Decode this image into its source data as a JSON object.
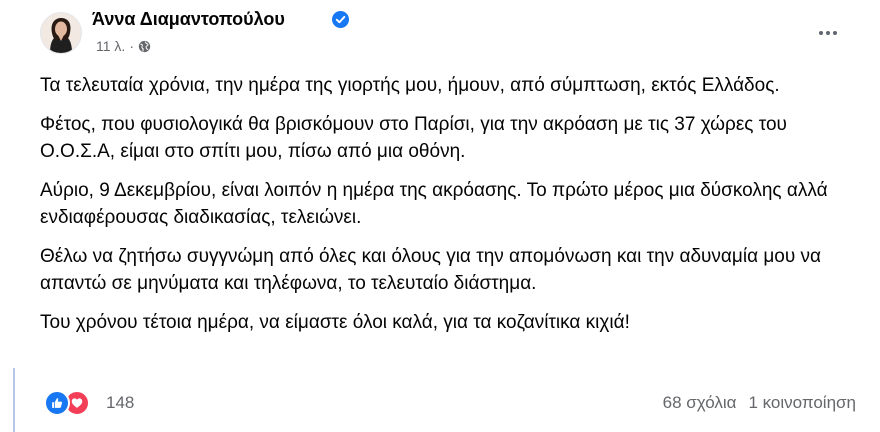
{
  "post": {
    "author_name": "Άννα Διαμαντοπούλου",
    "timestamp": "11 λ.",
    "dot": "·",
    "paragraphs": [
      "Τα τελευταία χρόνια, την ημέρα της γιορτής μου, ήμουν, από σύμπτωση, εκτός Ελλάδος.",
      "Φέτος, που φυσιολογικά θα βρισκόμουν στο Παρίσι, για την ακρόαση με τις 37 χώρες του Ο.Ο.Σ.Α, είμαι στο σπίτι μου, πίσω από μια οθόνη.",
      "Αύριο, 9 Δεκεμβρίου, είναι λοιπόν η ημέρα της ακρόασης. Το πρώτο μέρος μια δύσκολης αλλά ενδιαφέρουσας διαδικασίας, τελειώνει.",
      "Θέλω να ζητήσω συγγνώμη από όλες και όλους για την απομόνωση και την αδυναμία μου να απαντώ σε μηνύματα και τηλέφωνα, το τελευταίο διάστημα.",
      "Του χρόνου τέτοια ημέρα, να είμαστε όλοι καλά, για τα κοζανίτικα κιχιά!"
    ]
  },
  "footer": {
    "reaction_count": "148",
    "comments": "68 σχόλια",
    "shares": "1 κοινοποίηση"
  },
  "icons": {
    "verified": "verified-badge-icon",
    "privacy": "globe-icon",
    "more": "more-options-icon",
    "like": "like-icon",
    "love": "love-icon"
  },
  "colors": {
    "accent": "#1877f2",
    "love": "#f33e58",
    "secondary_text": "#65676b",
    "text": "#050505"
  }
}
